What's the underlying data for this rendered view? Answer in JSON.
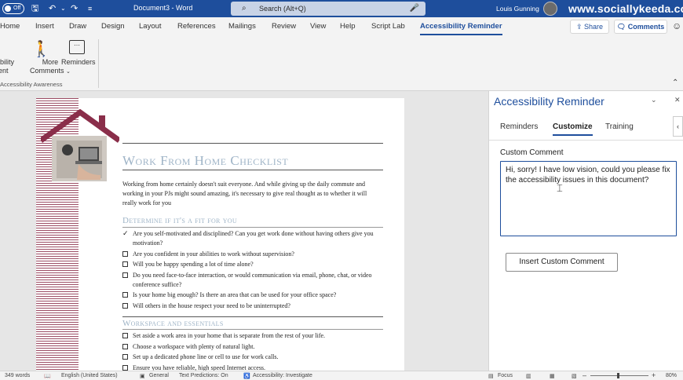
{
  "titlebar": {
    "autosave": "Off",
    "doc_title": "Document3  -  Word",
    "search_placeholder": "Search (Alt+Q)",
    "user_name": "Louis Gunning",
    "watermark": "www.sociallykeeda.com"
  },
  "tabs": [
    "Home",
    "Insert",
    "Draw",
    "Design",
    "Layout",
    "References",
    "Mailings",
    "Review",
    "View",
    "Help",
    "Script Lab",
    "Accessibility Reminder"
  ],
  "active_tab": "Accessibility Reminder",
  "share_label": "Share",
  "comments_label": "Comments",
  "ribbon": {
    "btn1_line1": "ibility",
    "btn1_line2": "ent",
    "more_comments_line1": "More",
    "more_comments_line2": "Comments",
    "reminders": "Reminders",
    "group_label": "Accessibility Awareness"
  },
  "document": {
    "heading": "Work From Home Checklist",
    "intro": "Working from home certainly doesn't suit everyone. And while giving up the daily commute and working in your PJs might sound amazing, it's necessary to give real thought as to whether it will really work for you",
    "section1": "Determine if it's a fit for you",
    "section1_items": [
      "Are you self-motivated and disciplined? Can you get work done without having others give you motivation?",
      "Are you confident in your abilities to work without supervision?",
      "Will you be happy spending a lot of time alone?",
      "Do you need face-to-face interaction, or would communication via email, phone, chat, or video conference suffice?",
      "Is your home big enough? Is there an area that can be used for your office space?",
      "Will others in the house respect your need to be uninterrupted?"
    ],
    "section2": "Workspace and essentials",
    "section2_items": [
      "Set aside a work area in your home that is separate from the rest of your life.",
      "Choose a workspace with plenty of natural light.",
      "Set up a dedicated phone line or cell to use for work calls.",
      "Ensure you have reliable, high speed Internet access."
    ]
  },
  "pane": {
    "title": "Accessibility Reminder",
    "tabs": [
      "Reminders",
      "Customize",
      "Training"
    ],
    "active_tab": "Customize",
    "custom_comment_label": "Custom Comment",
    "custom_comment_text": "Hi, sorry! I have low vision, could you please fix the accessibility issues in this document?",
    "insert_button": "Insert Custom Comment"
  },
  "statusbar": {
    "words": "349 words",
    "language": "English (United States)",
    "general": "General",
    "text_predictions": "Text Predictions: On",
    "accessibility": "Accessibility: Investigate",
    "focus": "Focus",
    "zoom": "80%"
  },
  "colors": {
    "accent": "#1e4e9c",
    "heading": "#9fb4c7",
    "stripe": "#8a2e4a"
  }
}
